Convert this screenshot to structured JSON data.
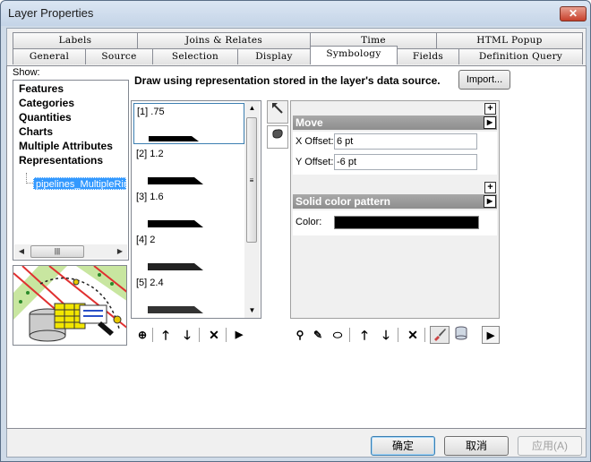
{
  "window": {
    "title": "Layer Properties",
    "close_label": "✕"
  },
  "tabs_back": [
    {
      "label": "Labels"
    },
    {
      "label": "Joins & Relates"
    },
    {
      "label": "Time"
    },
    {
      "label": "HTML Popup"
    }
  ],
  "tabs_front": [
    {
      "label": "General"
    },
    {
      "label": "Source"
    },
    {
      "label": "Selection"
    },
    {
      "label": "Display"
    },
    {
      "label": "Symbology",
      "active": true
    },
    {
      "label": "Fields"
    },
    {
      "label": "Definition Query"
    }
  ],
  "show": {
    "label": "Show:",
    "items": [
      "Features",
      "Categories",
      "Quantities",
      "Charts",
      "Multiple Attributes",
      "Representations"
    ],
    "selected_child": "pipelines_MultipleRin"
  },
  "description": "Draw using representation stored in the layer's data source.",
  "import_label": "Import...",
  "rules": [
    {
      "label": "[1] .75"
    },
    {
      "label": "[2] 1.2"
    },
    {
      "label": "[3] 1.6"
    },
    {
      "label": "[4] 2"
    },
    {
      "label": "[5] 2.4"
    }
  ],
  "properties": {
    "move": {
      "title": "Move",
      "x_offset_label": "X Offset:",
      "x_offset_value": "6 pt",
      "y_offset_label": "Y Offset:",
      "y_offset_value": "-6 pt"
    },
    "fill": {
      "title": "Solid color pattern",
      "color_label": "Color:",
      "color_value": "#000000"
    }
  },
  "buttons": {
    "ok": "确定",
    "cancel": "取消",
    "apply": "应用(A)"
  }
}
